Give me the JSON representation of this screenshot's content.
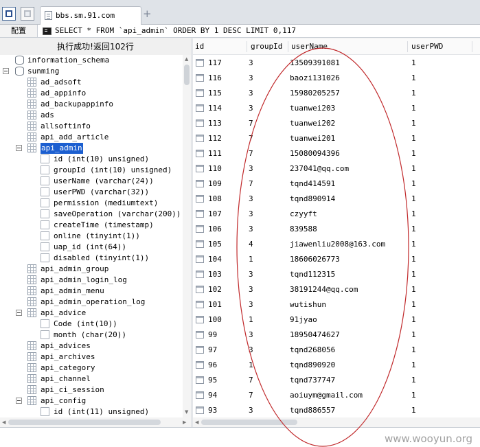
{
  "browser": {
    "tab_title": "bbs.sm.91.com",
    "new_tab_symbol": "+",
    "config_label": "配置",
    "query": "SELECT * FROM `api_admin` ORDER BY 1 DESC LIMIT 0,117"
  },
  "left_panel": {
    "status": "执行成功!返回102行",
    "tree": [
      {
        "label": "information_schema",
        "type": "db",
        "level": 0,
        "toggle": false
      },
      {
        "label": "sunming",
        "type": "db",
        "level": 0,
        "toggle": true
      },
      {
        "label": "ad_adsoft",
        "type": "table",
        "level": 1
      },
      {
        "label": "ad_appinfo",
        "type": "table",
        "level": 1
      },
      {
        "label": "ad_backupappinfo",
        "type": "table",
        "level": 1
      },
      {
        "label": "ads",
        "type": "table",
        "level": 1
      },
      {
        "label": "allsoftinfo",
        "type": "table",
        "level": 1
      },
      {
        "label": "api_add_article",
        "type": "table",
        "level": 1
      },
      {
        "label": "api_admin",
        "type": "table",
        "level": 1,
        "toggle": true,
        "selected": true
      },
      {
        "label": "id (int(10) unsigned)",
        "type": "column",
        "level": 2
      },
      {
        "label": "groupId (int(10) unsigned)",
        "type": "column",
        "level": 2
      },
      {
        "label": "userName (varchar(24))",
        "type": "column",
        "level": 2
      },
      {
        "label": "userPWD (varchar(32))",
        "type": "column",
        "level": 2
      },
      {
        "label": "permission (mediumtext)",
        "type": "column",
        "level": 2
      },
      {
        "label": "saveOperation (varchar(200))",
        "type": "column",
        "level": 2
      },
      {
        "label": "createTime (timestamp)",
        "type": "column",
        "level": 2
      },
      {
        "label": "online (tinyint(1))",
        "type": "column",
        "level": 2
      },
      {
        "label": "uap_id (int(64))",
        "type": "column",
        "level": 2
      },
      {
        "label": "disabled (tinyint(1))",
        "type": "column",
        "level": 2
      },
      {
        "label": "api_admin_group",
        "type": "table",
        "level": 1
      },
      {
        "label": "api_admin_login_log",
        "type": "table",
        "level": 1
      },
      {
        "label": "api_admin_menu",
        "type": "table",
        "level": 1
      },
      {
        "label": "api_admin_operation_log",
        "type": "table",
        "level": 1
      },
      {
        "label": "api_advice",
        "type": "table",
        "level": 1,
        "toggle": true
      },
      {
        "label": "Code (int(10))",
        "type": "column",
        "level": 2
      },
      {
        "label": "month (char(20))",
        "type": "column",
        "level": 2
      },
      {
        "label": "api_advices",
        "type": "table",
        "level": 1
      },
      {
        "label": "api_archives",
        "type": "table",
        "level": 1
      },
      {
        "label": "api_category",
        "type": "table",
        "level": 1
      },
      {
        "label": "api_channel",
        "type": "table",
        "level": 1
      },
      {
        "label": "api_ci_session",
        "type": "table",
        "level": 1
      },
      {
        "label": "api_config",
        "type": "table",
        "level": 1,
        "toggle": true
      },
      {
        "label": "id (int(11) unsigned)",
        "type": "column",
        "level": 2
      }
    ]
  },
  "grid": {
    "columns": [
      "id",
      "groupId",
      "userName",
      "userPWD"
    ],
    "rows": [
      [
        "117",
        "3",
        "13509391081",
        "1"
      ],
      [
        "116",
        "3",
        "baozi131026",
        "1"
      ],
      [
        "115",
        "3",
        "15980205257",
        "1"
      ],
      [
        "114",
        "3",
        "tuanwei203",
        "1"
      ],
      [
        "113",
        "7",
        "tuanwei202",
        "1"
      ],
      [
        "112",
        "7",
        "tuanwei201",
        "1"
      ],
      [
        "111",
        "7",
        "15080094396",
        "1"
      ],
      [
        "110",
        "3",
        "237041@qq.com",
        "1"
      ],
      [
        "109",
        "7",
        "tqnd414591",
        "1"
      ],
      [
        "108",
        "3",
        "tqnd890914",
        "1"
      ],
      [
        "107",
        "3",
        "czyyft",
        "1"
      ],
      [
        "106",
        "3",
        "839588",
        "1"
      ],
      [
        "105",
        "4",
        "jiawenliu2008@163.com",
        "1"
      ],
      [
        "104",
        "1",
        "18606026773",
        "1"
      ],
      [
        "103",
        "3",
        "tqnd112315",
        "1"
      ],
      [
        "102",
        "3",
        "38191244@qq.com",
        "1"
      ],
      [
        "101",
        "3",
        "wutishun",
        "1"
      ],
      [
        "100",
        "1",
        "91jyao",
        "1"
      ],
      [
        "99",
        "3",
        "18950474627",
        "1"
      ],
      [
        "97",
        "3",
        "tqnd268056",
        "1"
      ],
      [
        "96",
        "1",
        "tqnd890920",
        "1"
      ],
      [
        "95",
        "7",
        "tqnd737747",
        "1"
      ],
      [
        "94",
        "7",
        "aoiuym@gmail.com",
        "1"
      ],
      [
        "93",
        "3",
        "tqnd886557",
        "1"
      ]
    ]
  },
  "watermark": "www.wooyun.org",
  "colors": {
    "selection": "#1c5fd0",
    "annotation": "#c0282a"
  }
}
